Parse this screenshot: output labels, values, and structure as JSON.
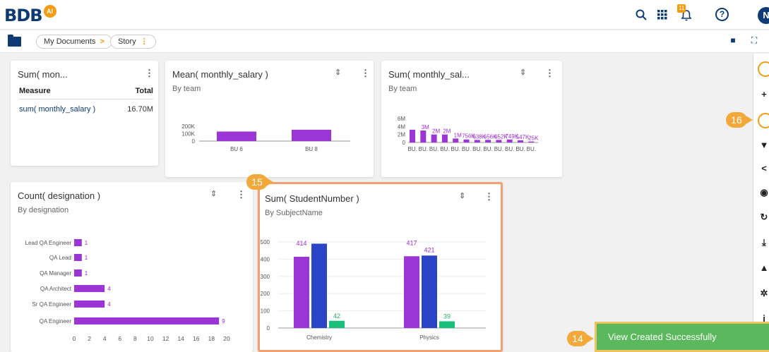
{
  "app": {
    "logo_text": "BDB",
    "logo_badge": "AI",
    "user_initial": "N",
    "notification_count": "11",
    "help_symbol": "?"
  },
  "breadcrumb": {
    "items": [
      "My Documents",
      "Story"
    ]
  },
  "icons": {
    "top": [
      "search-icon",
      "apps-grid-icon",
      "bell-icon",
      "help-icon",
      "user-avatar"
    ],
    "crumbbar_right": [
      "comment-icon",
      "fullscreen-icon"
    ],
    "sidebar": [
      "circle-icon",
      "plus-icon",
      "save-icon",
      "filter-icon",
      "share-icon",
      "eye-icon",
      "refresh-icon",
      "export-icon",
      "bell-icon",
      "settings-icon",
      "info-icon"
    ]
  },
  "cards": {
    "table": {
      "title": "Sum( mon...",
      "col_measure": "Measure",
      "col_total": "Total",
      "row_measure": "sum( monthly_salary )",
      "row_total": "16.70M"
    },
    "mean": {
      "title": "Mean( monthly_salary )",
      "subtitle": "By team"
    },
    "sumteam": {
      "title": "Sum( monthly_sal...",
      "subtitle": "By team"
    },
    "count": {
      "title": "Count( designation )",
      "subtitle": "By designation"
    },
    "student": {
      "title": "Sum( StudentNumber )",
      "subtitle": "By SubjectName"
    }
  },
  "chart_data": [
    {
      "type": "bar",
      "title": "Mean( monthly_salary )",
      "subtitle": "By team",
      "categories": [
        "BU 6",
        "BU 8"
      ],
      "values": [
        130000,
        155000
      ],
      "y_ticks": [
        "0",
        "100K",
        "200K"
      ],
      "ylim": [
        0,
        250000
      ],
      "color": "#9b35d6"
    },
    {
      "type": "bar",
      "title": "Sum( monthly_sal...",
      "subtitle": "By team",
      "categories": [
        "BU.",
        "BU.",
        "BU.",
        "BU.",
        "BU.",
        "BU.",
        "BU.",
        "BU.",
        "BU.",
        "BU.",
        "BU.",
        "BU."
      ],
      "values": [
        3.2,
        3.0,
        2.0,
        2.0,
        1.0,
        0.756,
        0.638,
        0.656,
        0.652,
        0.749,
        0.547,
        0.25
      ],
      "data_labels": [
        "",
        "3M",
        "2M",
        "2M",
        "1M",
        "756K",
        "638K",
        "656K",
        "652K",
        "749K",
        "547K",
        "25K"
      ],
      "y_ticks": [
        "0",
        "2M",
        "4M",
        "6M"
      ],
      "ylim": [
        0,
        6
      ],
      "color": "#9b35d6"
    },
    {
      "type": "bar",
      "orientation": "horizontal",
      "title": "Count( designation )",
      "subtitle": "By designation",
      "categories": [
        "Lead QA Engineer",
        "QA Lead",
        "QA Manager",
        "QA Architect",
        "Sr QA Engineer",
        "QA Engineer"
      ],
      "values": [
        1,
        1,
        1,
        4,
        4,
        19
      ],
      "data_labels": [
        "1",
        "1",
        "1",
        "4",
        "4",
        "9"
      ],
      "x_ticks": [
        "0",
        "2",
        "4",
        "6",
        "8",
        "10",
        "12",
        "14",
        "16",
        "18",
        "20"
      ],
      "xlim": [
        0,
        20
      ],
      "color": "#9b35d6"
    },
    {
      "type": "bar",
      "title": "Sum( StudentNumber )",
      "subtitle": "By SubjectName",
      "categories": [
        "Chemistry",
        "Physics"
      ],
      "series": [
        {
          "values": [
            414,
            417
          ],
          "color": "#9b35d6",
          "labels": [
            "414",
            "417"
          ]
        },
        {
          "values": [
            490,
            421
          ],
          "color": "#2a44c8",
          "labels": [
            "",
            "421"
          ]
        },
        {
          "values": [
            42,
            39
          ],
          "color": "#19c07a",
          "labels": [
            "42",
            "39"
          ]
        }
      ],
      "y_ticks": [
        "0",
        "100",
        "200",
        "300",
        "400",
        "500"
      ],
      "ylim": [
        0,
        500
      ]
    }
  ],
  "annotations": {
    "step_14": "14",
    "step_15": "15",
    "step_16": "16"
  },
  "toast": {
    "message": "View Created Successfully"
  }
}
